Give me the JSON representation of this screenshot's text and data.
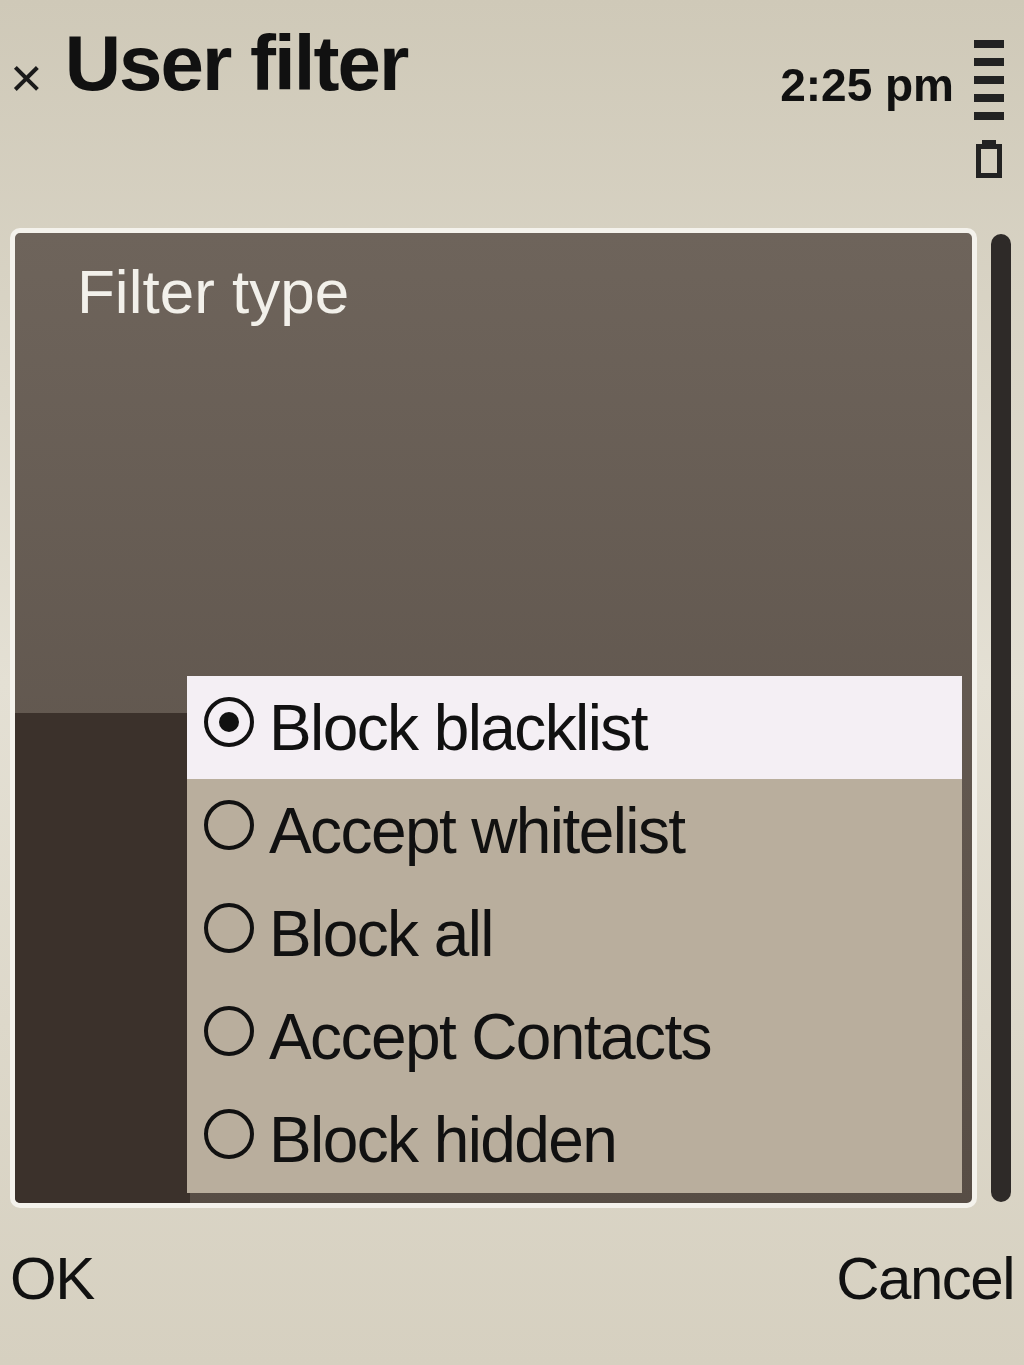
{
  "header": {
    "close": "×",
    "title": "User filter",
    "time": "2:25 pm"
  },
  "dialog": {
    "title": "Filter type",
    "options": [
      {
        "label": "Block blacklist",
        "selected": true
      },
      {
        "label": "Accept whitelist",
        "selected": false
      },
      {
        "label": "Block all",
        "selected": false
      },
      {
        "label": "Accept Contacts",
        "selected": false
      },
      {
        "label": "Block hidden",
        "selected": false
      }
    ]
  },
  "softkeys": {
    "left": "OK",
    "right": "Cancel"
  }
}
